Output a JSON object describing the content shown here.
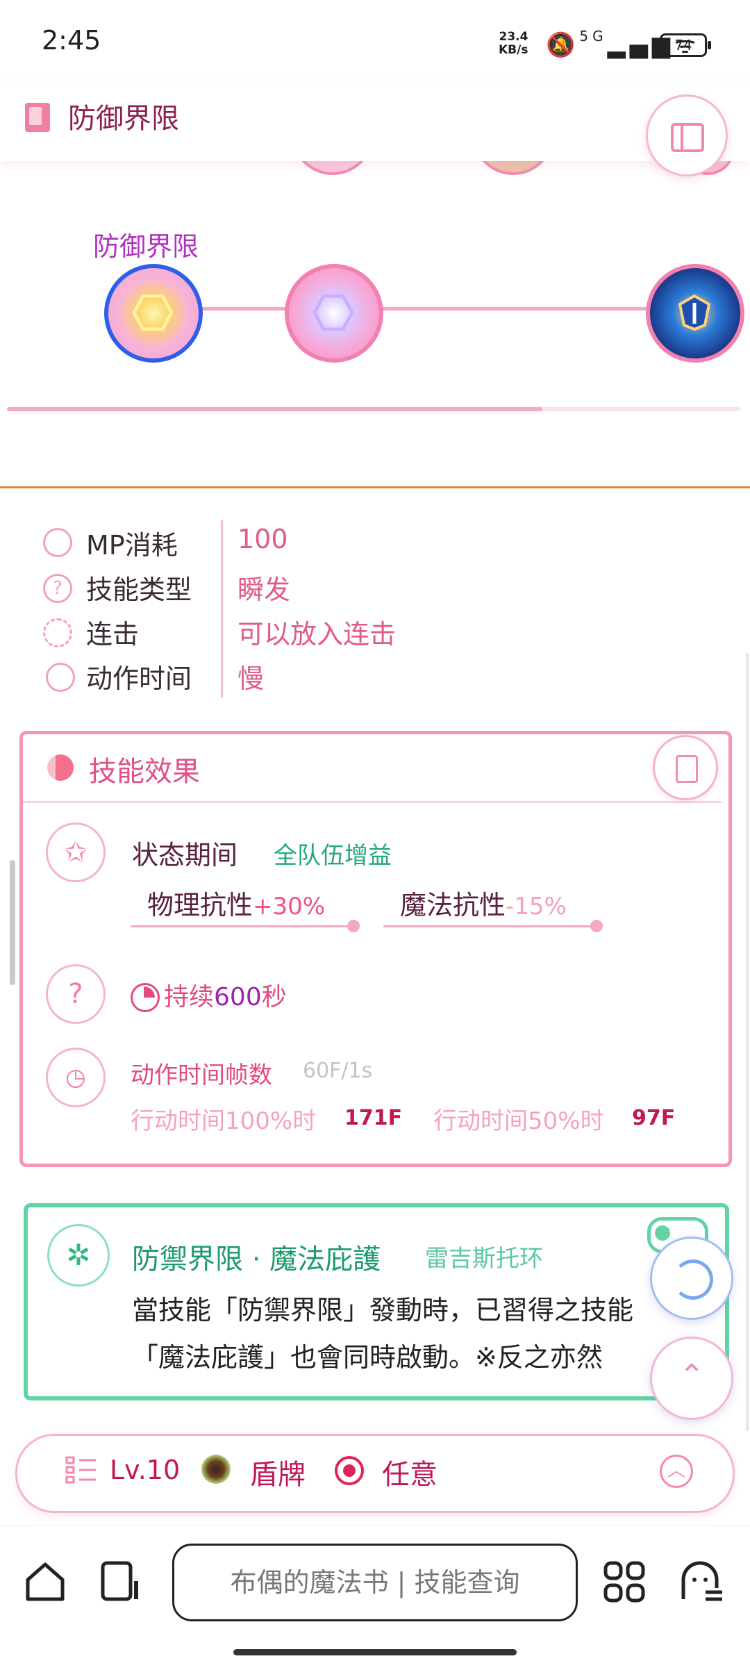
{
  "status_bar": {
    "time": "2:45",
    "net_speed_top": "23.4",
    "net_speed_bottom": "KB/s",
    "signal_text": "5G",
    "battery": "74"
  },
  "header": {
    "title": "防御界限"
  },
  "skill_tree": {
    "selected_label": "防御界限",
    "progress": 0.73
  },
  "stats": [
    {
      "label": "MP消耗",
      "value": "100",
      "icon": "mp-potion-icon"
    },
    {
      "label": "技能类型",
      "value": "瞬发",
      "icon": "question-icon"
    },
    {
      "label": "连击",
      "value": "可以放入连击",
      "icon": "combo-icon"
    },
    {
      "label": "动作时间",
      "value": "慢",
      "icon": "stopwatch-icon"
    }
  ],
  "effect": {
    "title": "技能效果",
    "state_label": "状态期间",
    "buff_tag": "全队伍增益",
    "phys_label": "物理抗性",
    "phys_value": "+30%",
    "magic_label": "魔法抗性",
    "magic_value": "-15%",
    "question_mark": "?",
    "duration_prefix": "持续",
    "duration_value": "600",
    "duration_unit": "秒",
    "frames_label": "动作时间帧数",
    "frames_rate": "60F/1s",
    "action100_label": "行动时间100%时",
    "action100_value": "171F",
    "action50_label": "行动时间50%时",
    "action50_value": "97F"
  },
  "linked": {
    "title": "防禦界限 · 魔法庇護",
    "subtitle": "雷吉斯托环",
    "line1": "當技能「防禦界限」發動時，已習得之技能",
    "line2": "「魔法庇護」也會同時啟動。※反之亦然"
  },
  "bottom_bar": {
    "level": "Lv.10",
    "weapon": "盾牌",
    "mode": "任意"
  },
  "browser": {
    "search_placeholder": "布偶的魔法书 | 技能查询"
  },
  "colors": {
    "accent_pink": "#f5a8c3",
    "card_green": "#62d4a4",
    "divider_orange": "#e8823c"
  }
}
